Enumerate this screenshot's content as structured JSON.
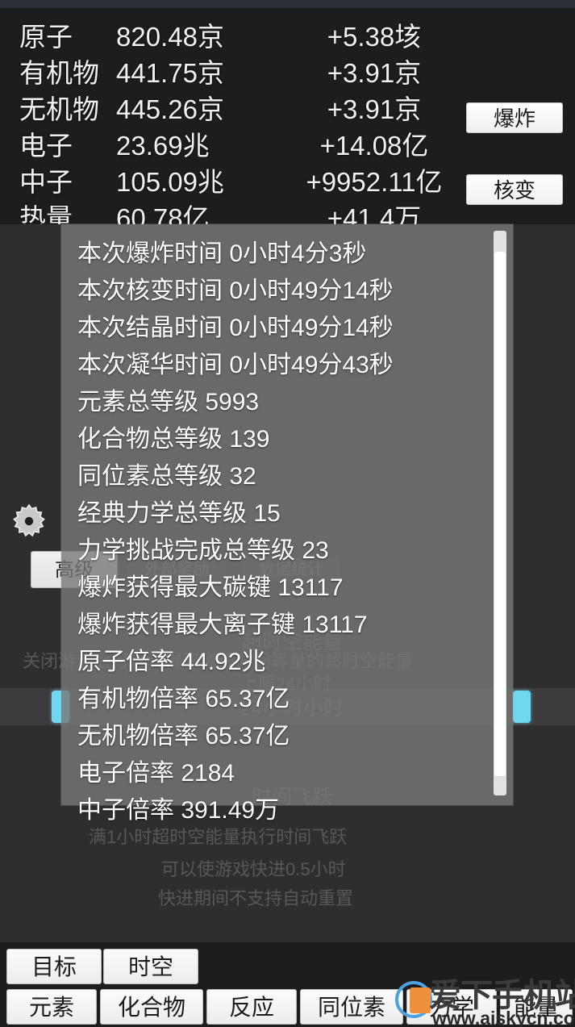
{
  "resources": {
    "columns": [
      "name",
      "amount",
      "rate"
    ],
    "rows": [
      {
        "name": "原子",
        "amount": "820.48京",
        "rate": "+5.38垓"
      },
      {
        "name": "有机物",
        "amount": "441.75京",
        "rate": "+3.91京"
      },
      {
        "name": "无机物",
        "amount": "445.26京",
        "rate": "+3.91京"
      },
      {
        "name": "电子",
        "amount": "23.69兆",
        "rate": "+14.08亿"
      },
      {
        "name": "中子",
        "amount": "105.09兆",
        "rate": "+9952.11亿"
      },
      {
        "name": "热量",
        "amount": "60.78亿",
        "rate": "+41.4万"
      }
    ]
  },
  "actions": {
    "explode_label": "爆炸",
    "fusion_label": "核变"
  },
  "background_panel": {
    "gear_icon": "gear-icon",
    "tabs": [
      {
        "label": "高级"
      },
      {
        "label": "外部奖励"
      },
      {
        "label": "数据统计"
      }
    ],
    "ghost_lines": [
      "超时空能量",
      "关闭游戏后可以获得和离线时间等量的超时空能量",
      "上限24小时",
      "24小时小时",
      "时间飞跃",
      "满1小时超时空能量执行时间飞跃",
      "可以使游戏快进0.5小时",
      "快进期间不支持自动重置"
    ]
  },
  "stats_modal": {
    "lines": [
      "本次爆炸时间 0小时4分3秒",
      "本次核变时间 0小时49分14秒",
      "本次结晶时间 0小时49分14秒",
      "本次凝华时间 0小时49分43秒",
      "元素总等级 5993",
      "化合物总等级 139",
      "同位素总等级 32",
      "经典力学总等级 15",
      "力学挑战完成总等级 23",
      "爆炸获得最大碳键 13117",
      "爆炸获得最大离子键 13117",
      "原子倍率 44.92兆",
      "有机物倍率 65.37亿",
      "无机物倍率 65.37亿",
      "电子倍率 2184",
      "中子倍率 391.49万"
    ],
    "scrollbar": "vertical-scrollbar"
  },
  "bottom_nav": {
    "row1": [
      {
        "label": "目标"
      },
      {
        "label": "时空"
      }
    ],
    "row2": [
      {
        "label": "元素"
      },
      {
        "label": "化合物"
      },
      {
        "label": "反应"
      },
      {
        "label": "同位素"
      },
      {
        "label": "力学"
      },
      {
        "label": "能量"
      }
    ]
  },
  "watermark": {
    "site_name": "爱下手机站",
    "url": "www.aiskycn.com"
  },
  "colors": {
    "background": "#232526",
    "panel": "#2e2e2e",
    "modal": "#787878",
    "accent_cyan": "#6fd8ee",
    "button_face": "#fcfcfc",
    "text_light": "#ffffff",
    "watermark_blue": "#4ea3de",
    "watermark_orange": "#f0903a"
  }
}
